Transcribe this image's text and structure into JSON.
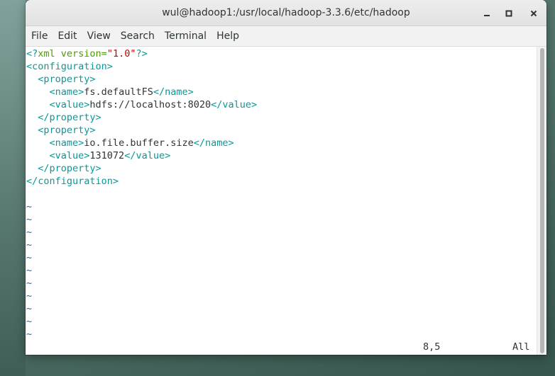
{
  "window": {
    "title": "wul@hadoop1:/usr/local/hadoop-3.3.6/etc/hadoop",
    "buttons": {
      "minimize_icon": "minimize-icon",
      "maximize_icon": "maximize-icon",
      "close_icon": "close-icon"
    }
  },
  "menu": [
    "File",
    "Edit",
    "View",
    "Search",
    "Terminal",
    "Help"
  ],
  "editor": {
    "xml_decl": {
      "open": "<?",
      "name": "xml",
      "attr": " version=",
      "value": "\"1.0\"",
      "close": "?>"
    },
    "lines": [
      {
        "indent": "",
        "parts": [
          {
            "t": "tag",
            "v": "<configuration>"
          }
        ]
      },
      {
        "indent": "  ",
        "parts": [
          {
            "t": "tag",
            "v": "<property>"
          }
        ]
      },
      {
        "indent": "    ",
        "parts": [
          {
            "t": "tag",
            "v": "<name>"
          },
          {
            "t": "txt",
            "v": "fs.defaultFS"
          },
          {
            "t": "tag",
            "v": "</name>"
          }
        ]
      },
      {
        "indent": "    ",
        "parts": [
          {
            "t": "tag",
            "v": "<value>"
          },
          {
            "t": "txt",
            "v": "hdfs://localhost:8020"
          },
          {
            "t": "tag",
            "v": "</value>"
          }
        ]
      },
      {
        "indent": "  ",
        "parts": [
          {
            "t": "tag",
            "v": "</property>"
          }
        ]
      },
      {
        "indent": "  ",
        "parts": [
          {
            "t": "tag",
            "v": "<property>"
          }
        ]
      },
      {
        "indent": "    ",
        "parts": [
          {
            "t": "tag",
            "v": "<name>"
          },
          {
            "t": "txt",
            "v": "io.file.buffer.size"
          },
          {
            "t": "tag",
            "v": "</name>"
          }
        ]
      },
      {
        "indent": "    ",
        "parts": [
          {
            "t": "tag",
            "v": "<value>"
          },
          {
            "t": "txt",
            "v": "131072"
          },
          {
            "t": "tag",
            "v": "</value>"
          }
        ]
      },
      {
        "indent": "  ",
        "parts": [
          {
            "t": "tag",
            "v": "</property>"
          }
        ]
      },
      {
        "indent": "",
        "parts": [
          {
            "t": "tag",
            "v": "</configuration>"
          }
        ]
      },
      {
        "indent": "",
        "parts": []
      }
    ],
    "tilde_char": "~",
    "tilde_count": 11,
    "status_position": "8,5",
    "status_scroll": "All"
  },
  "colors": {
    "tag": "#06989a",
    "text": "#2e3436",
    "string": "#cc0000",
    "tilde": "#3465a4",
    "keyword": "#4e9a06"
  }
}
